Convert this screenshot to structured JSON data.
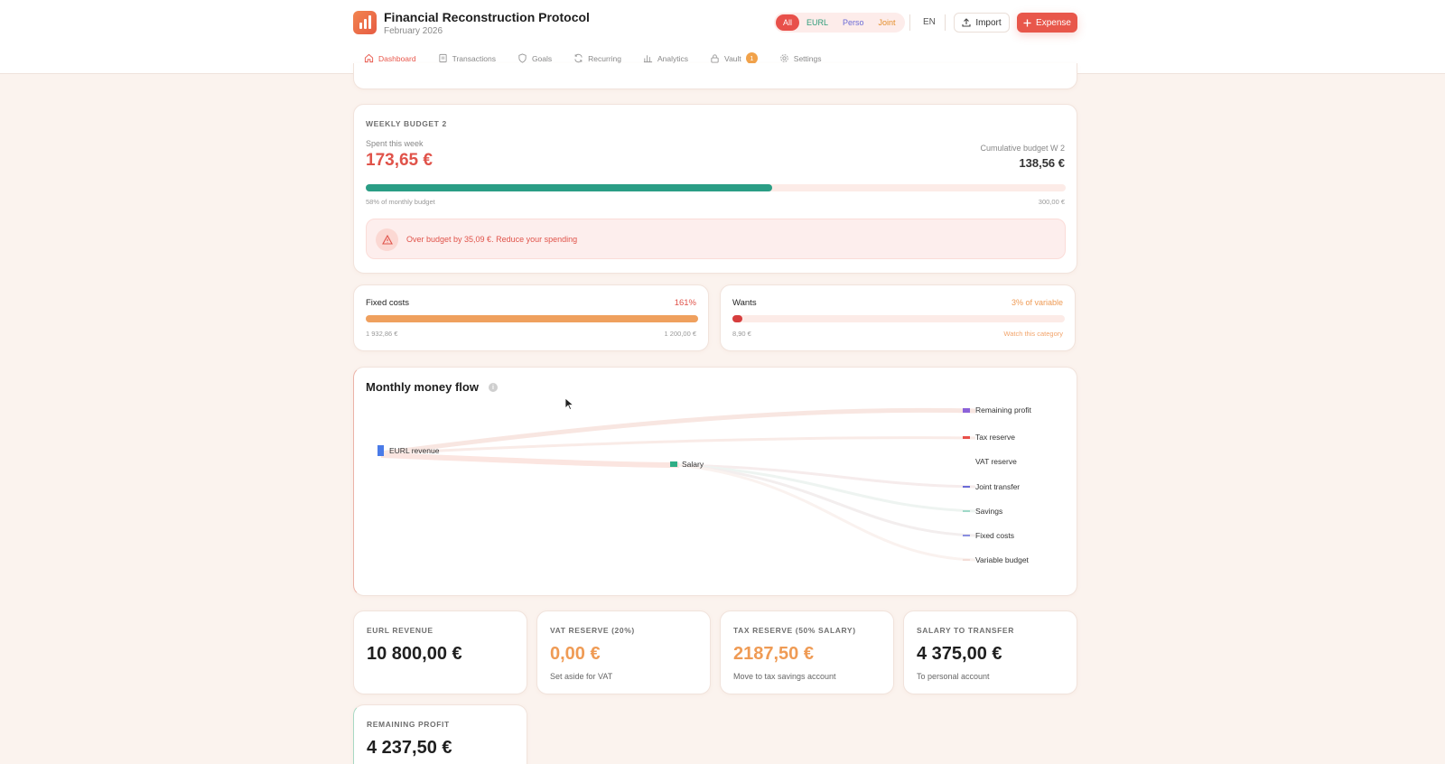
{
  "app": {
    "title": "Financial Reconstruction Protocol",
    "subtitle": "February 2026"
  },
  "filters": {
    "all": "All",
    "eurl": "EURL",
    "perso": "Perso",
    "joint": "Joint"
  },
  "header": {
    "lang": "EN",
    "import_label": "Import",
    "expense_label": "Expense"
  },
  "nav": {
    "dashboard": "Dashboard",
    "transactions": "Transactions",
    "goals": "Goals",
    "recurring": "Recurring",
    "analytics": "Analytics",
    "vault": "Vault",
    "vault_badge": "1",
    "settings": "Settings"
  },
  "weekly": {
    "title": "WEEKLY BUDGET 2",
    "spent_label": "Spent this week",
    "spent_value": "173,65 €",
    "cumulative_label": "Cumulative budget W 2",
    "cumulative_value": "138,56 €",
    "progress": 0.58,
    "progress_caption": "58% of monthly budget",
    "monthly_budget": "300,00 €",
    "alert": "Over budget by 35,09 €. Reduce your spending"
  },
  "categories": {
    "fixed": {
      "label": "Fixed costs",
      "pct": "161%",
      "progress": 1.0,
      "spent": "1 932,86 €",
      "budget": "1 200,00 €"
    },
    "wants": {
      "label": "Wants",
      "pct": "3% of variable",
      "progress": 0.03,
      "spent": "8,90 €",
      "note": "Watch this category"
    }
  },
  "flow": {
    "title": "Monthly money flow",
    "source": "EURL revenue",
    "mid": "Salary",
    "targets": {
      "remaining_profit": "Remaining profit",
      "tax_reserve": "Tax reserve",
      "vat_reserve": "VAT reserve",
      "joint_transfer": "Joint transfer",
      "savings": "Savings",
      "fixed_costs": "Fixed costs",
      "variable_budget": "Variable budget"
    },
    "colors": {
      "source": "#4a7be8",
      "salary": "#2fae86",
      "remaining_profit": "#8b62d9",
      "tax_reserve": "#e8504a",
      "joint_transfer": "#6b6bd6",
      "savings": "#9fd9c8",
      "fixed_costs": "#8a8fe0",
      "variable_budget": "#f3ddd7"
    }
  },
  "stats": {
    "eurl_revenue": {
      "label": "EURL REVENUE",
      "value": "10 800,00 €"
    },
    "vat_reserve": {
      "label": "VAT RESERVE (20%)",
      "value": "0,00 €",
      "hint": "Set aside for VAT"
    },
    "tax_reserve": {
      "label": "TAX RESERVE (50% SALARY)",
      "value": "2187,50 €",
      "hint": "Move to tax savings account"
    },
    "salary_transfer": {
      "label": "SALARY TO TRANSFER",
      "value": "4 375,00 €",
      "hint": "To personal account"
    },
    "remaining_profit": {
      "label": "REMAINING PROFIT",
      "value": "4 237,50 €"
    }
  },
  "colors": {
    "accent": "#e8574b",
    "teal": "#2a9d85",
    "orange": "#efa05e",
    "warn": "#e48f2c"
  }
}
